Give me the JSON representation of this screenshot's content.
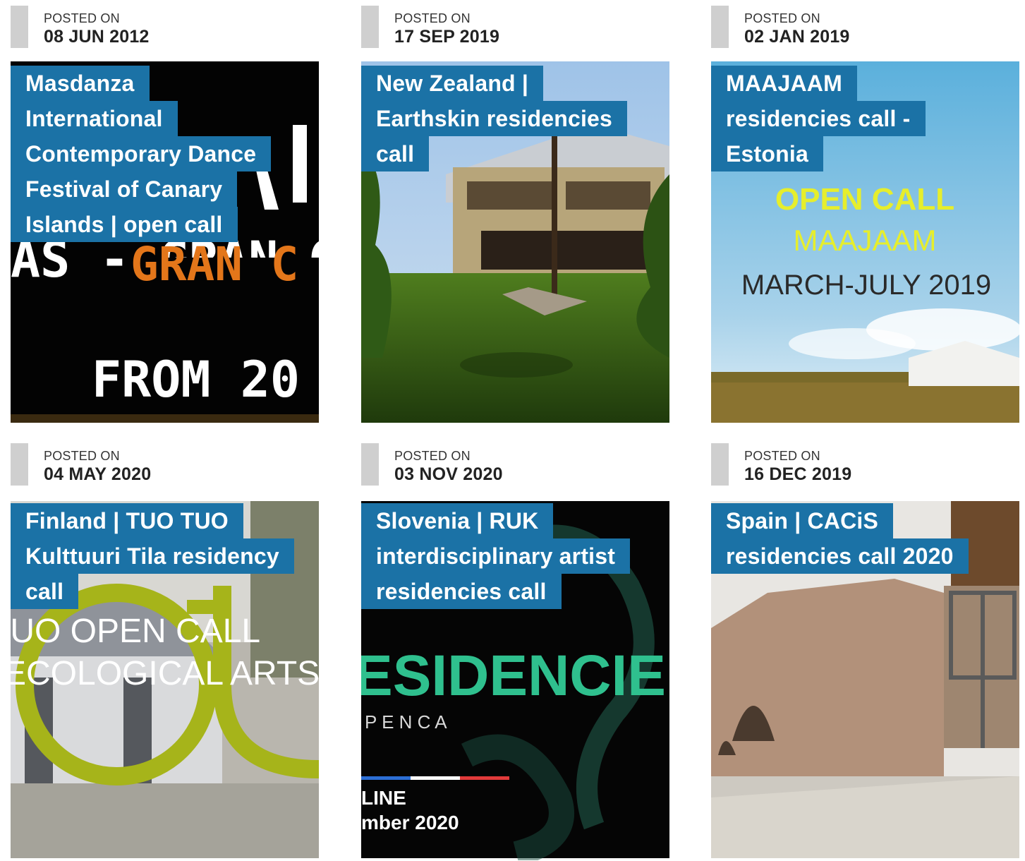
{
  "labels": {
    "posted_on": "POSTED ON"
  },
  "posts": [
    {
      "date": "08 JUN 2012",
      "title_lines": [
        "Masdanza",
        "International",
        "Contemporary Dance",
        "Festival of Canary",
        "Islands | open call"
      ],
      "image_text": [
        "AS - GRAN C",
        "FROM 20"
      ]
    },
    {
      "date": "17 SEP 2019",
      "title_lines": [
        "New Zealand |",
        "Earthskin residencies",
        "call"
      ],
      "image_text": []
    },
    {
      "date": "02 JAN 2019",
      "title_lines": [
        "MAAJAAM",
        "residencies call -",
        "Estonia"
      ],
      "image_text": [
        "OPEN CALL",
        "MAAJAAM",
        "MARCH-JULY 2019"
      ]
    },
    {
      "date": "04 MAY 2020",
      "title_lines": [
        "Finland | TUO TUO",
        "Kulttuuri Tila residency",
        "call"
      ],
      "image_text": [
        "TUO OPEN CALL",
        "ECOLOGICAL ARTS"
      ]
    },
    {
      "date": "03 NOV 2020",
      "title_lines": [
        "Slovenia | RUK",
        "interdisciplinary artist",
        "residencies call"
      ],
      "image_text": [
        "ESIDENCIE",
        "P  E  N    C  A",
        "LINE",
        "mber 2020"
      ]
    },
    {
      "date": "16 DEC 2019",
      "title_lines": [
        "Spain | CACiS",
        "residencies call 2020"
      ],
      "image_text": []
    }
  ],
  "colors": {
    "title_bg": "#1b72a6",
    "date_bar": "#cfcfcf"
  }
}
